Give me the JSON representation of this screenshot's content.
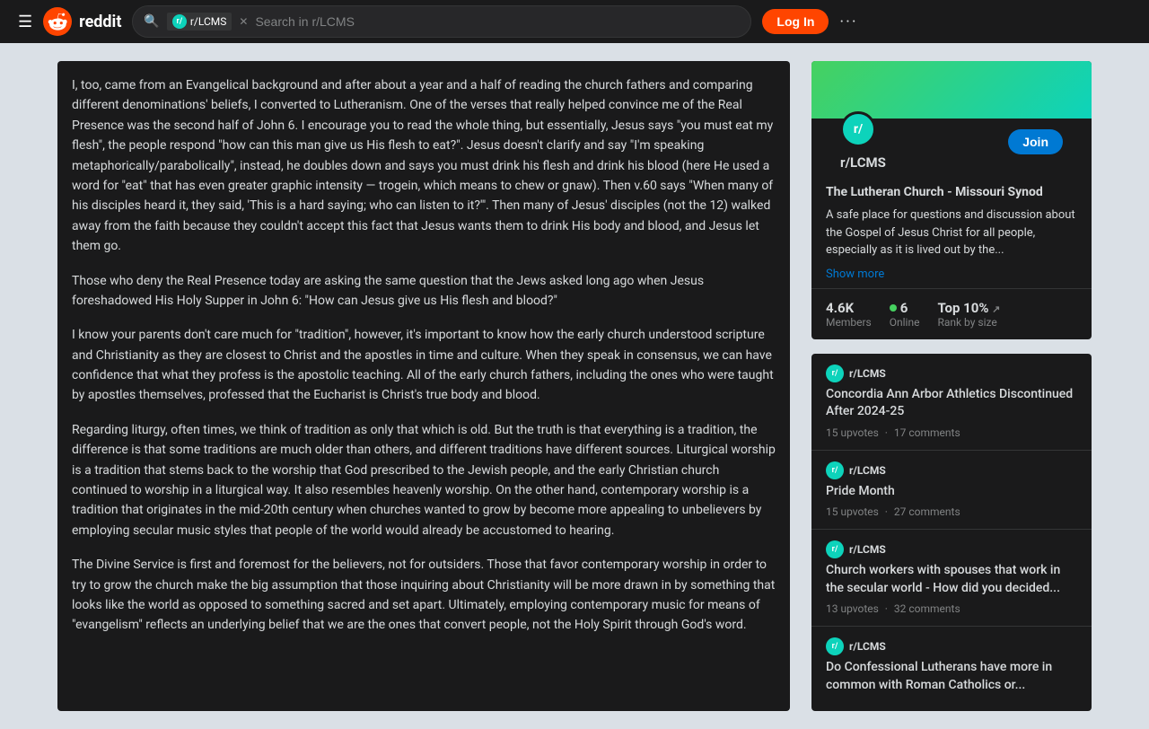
{
  "header": {
    "hamburger": "☰",
    "reddit_text": "reddit",
    "search_placeholder": "Search in r/LCMS",
    "subreddit_tag": "r/LCMS",
    "login_label": "Log In",
    "more": "···"
  },
  "post": {
    "paragraphs": [
      "I, too, came from an Evangelical background and after about a year and a half of reading the church fathers and comparing different denominations' beliefs, I converted to Lutheranism.  One of the verses that really helped convince me of the Real Presence was the second half of John 6. I encourage you to read the whole thing, but essentially, Jesus says \"you must eat my flesh\", the people respond \"how can this man give us His flesh to eat?\". Jesus doesn't clarify and say \"I'm speaking metaphorically/parabolically\", instead, he doubles down and says you must drink his flesh and drink his blood (here He used a word for \"eat\" that has even greater graphic intensity — trogein, which means to chew or gnaw). Then v.60 says \"When many of his disciples heard it, they said, 'This is a hard saying; who can listen to it?'\". Then many of Jesus' disciples (not the 12) walked away from the faith because they couldn't accept this fact that Jesus wants them to drink His body and blood, and Jesus let them go.",
      "Those who deny the Real Presence today are asking the same question that the Jews asked long ago when Jesus foreshadowed His Holy Supper in John 6: \"How can Jesus give us His flesh and blood?\"",
      "I know your parents don't care much for \"tradition\", however, it's important to know how the early church understood scripture and Christianity as they are closest to Christ and the apostles in time and culture. When they speak in consensus, we can have confidence that what they profess is the apostolic teaching. All of the early church fathers, including the ones who were taught by apostles themselves, professed that the Eucharist is Christ's true body and blood.",
      "Regarding liturgy, often times, we think of tradition as only that which is old. But the truth is that everything is a tradition, the difference is that some traditions are much older than others, and different traditions have different sources. Liturgical worship is a tradition that stems back to the worship that God prescribed to the Jewish people, and the early Christian church continued to worship in a liturgical way. It also resembles heavenly worship. On the other hand, contemporary worship is a tradition that originates in the mid-20th century when churches wanted to grow by become more appealing to unbelievers by employing secular music styles that people of the world would already be accustomed to hearing.",
      "The Divine Service is first and foremost for the believers, not for outsiders. Those that favor contemporary worship in order to try to grow the church make the big assumption that those inquiring about Christianity will be more drawn in by something that looks like the world as opposed to something sacred and set apart. Ultimately, employing contemporary music for means of \"evangelism\" reflects an underlying belief that we are the ones that convert people, not the Holy Spirit through God's word."
    ]
  },
  "sidebar": {
    "community": {
      "name": "r/LCMS",
      "full_name": "The Lutheran Church - Missouri Synod",
      "description": "A safe place for questions and discussion about the Gospel of Jesus Christ for all people, especially as it is lived out by the...",
      "show_more": "Show more",
      "join_label": "Join",
      "stats": {
        "members": "4.6K",
        "members_label": "Members",
        "online": "6",
        "online_label": "Online",
        "rank": "Top 10%",
        "rank_label": "Rank by size"
      }
    },
    "related_posts": [
      {
        "subreddit": "r/LCMS",
        "title": "Concordia Ann Arbor Athletics Discontinued After 2024-25",
        "upvotes": "15 upvotes",
        "separator": "·",
        "comments": "17 comments"
      },
      {
        "subreddit": "r/LCMS",
        "title": "Pride Month",
        "upvotes": "15 upvotes",
        "separator": "·",
        "comments": "27 comments"
      },
      {
        "subreddit": "r/LCMS",
        "title": "Church workers with spouses that work in the secular world - How did you decided...",
        "upvotes": "13 upvotes",
        "separator": "·",
        "comments": "32 comments"
      },
      {
        "subreddit": "r/LCMS",
        "title": "Do Confessional Lutherans have more in common with Roman Catholics or...",
        "upvotes": "",
        "separator": "",
        "comments": ""
      }
    ]
  }
}
